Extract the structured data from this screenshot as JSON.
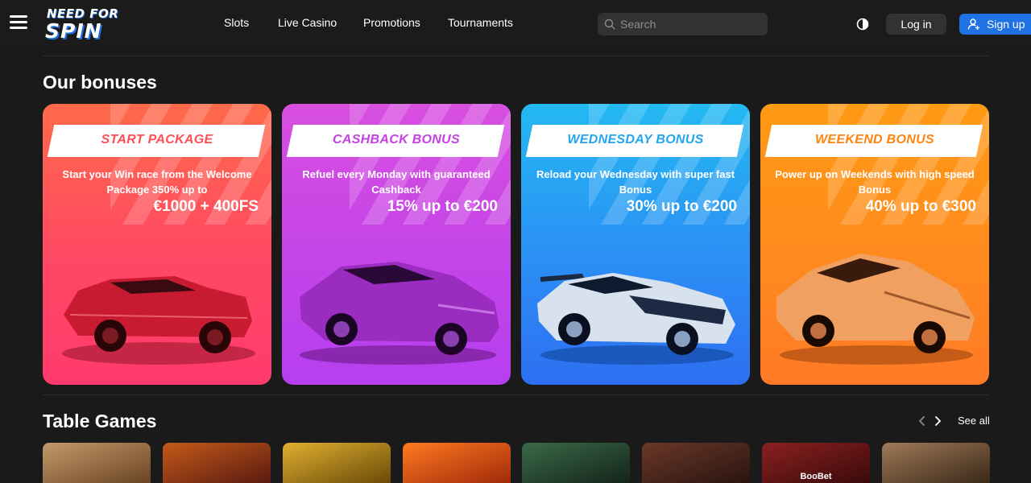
{
  "header": {
    "logo_line1": "NEED FOR",
    "logo_line2": "SPIN",
    "nav": [
      "Slots",
      "Live Casino",
      "Promotions",
      "Tournaments"
    ],
    "search_placeholder": "Search",
    "login_label": "Log in",
    "signup_label": "Sign up",
    "accent_color": "#1f72e3"
  },
  "bonuses": {
    "title": "Our bonuses",
    "cards": [
      {
        "banner": "START PACKAGE",
        "description": "Start your Win race from the Welcome Package 350% up to",
        "amount": "€1000 + 400FS",
        "color": "#ff4863",
        "car_icon": "red-muscle-car"
      },
      {
        "banner": "CASHBACK BONUS",
        "description": "Refuel every Monday with guaranteed Cashback",
        "amount": "15% up to €200",
        "color": "#c444e8",
        "car_icon": "purple-sports-car"
      },
      {
        "banner": "WEDNESDAY BONUS",
        "description": "Reload your Wednesday with super fast Bonus",
        "amount": "30% up to €200",
        "color": "#2b8ff4",
        "car_icon": "silver-race-car"
      },
      {
        "banner": "WEEKEND BONUS",
        "description": "Power up on Weekends with high speed Bonus",
        "amount": "40% up to €300",
        "color": "#ff8a1e",
        "car_icon": "orange-sports-car"
      }
    ]
  },
  "table_games": {
    "title": "Table Games",
    "see_all": "See all",
    "thumbs": [
      {
        "color": "#8a6240",
        "label": ""
      },
      {
        "color": "#7a2a1a",
        "label": ""
      },
      {
        "color": "#7a5a10",
        "label": ""
      },
      {
        "color": "#a2350f",
        "label": ""
      },
      {
        "color": "#1f3828",
        "label": ""
      },
      {
        "color": "#3a1e18",
        "label": ""
      },
      {
        "color": "#4a1a1a",
        "label": "BooBet"
      },
      {
        "color": "#5a4030",
        "label": ""
      }
    ]
  }
}
